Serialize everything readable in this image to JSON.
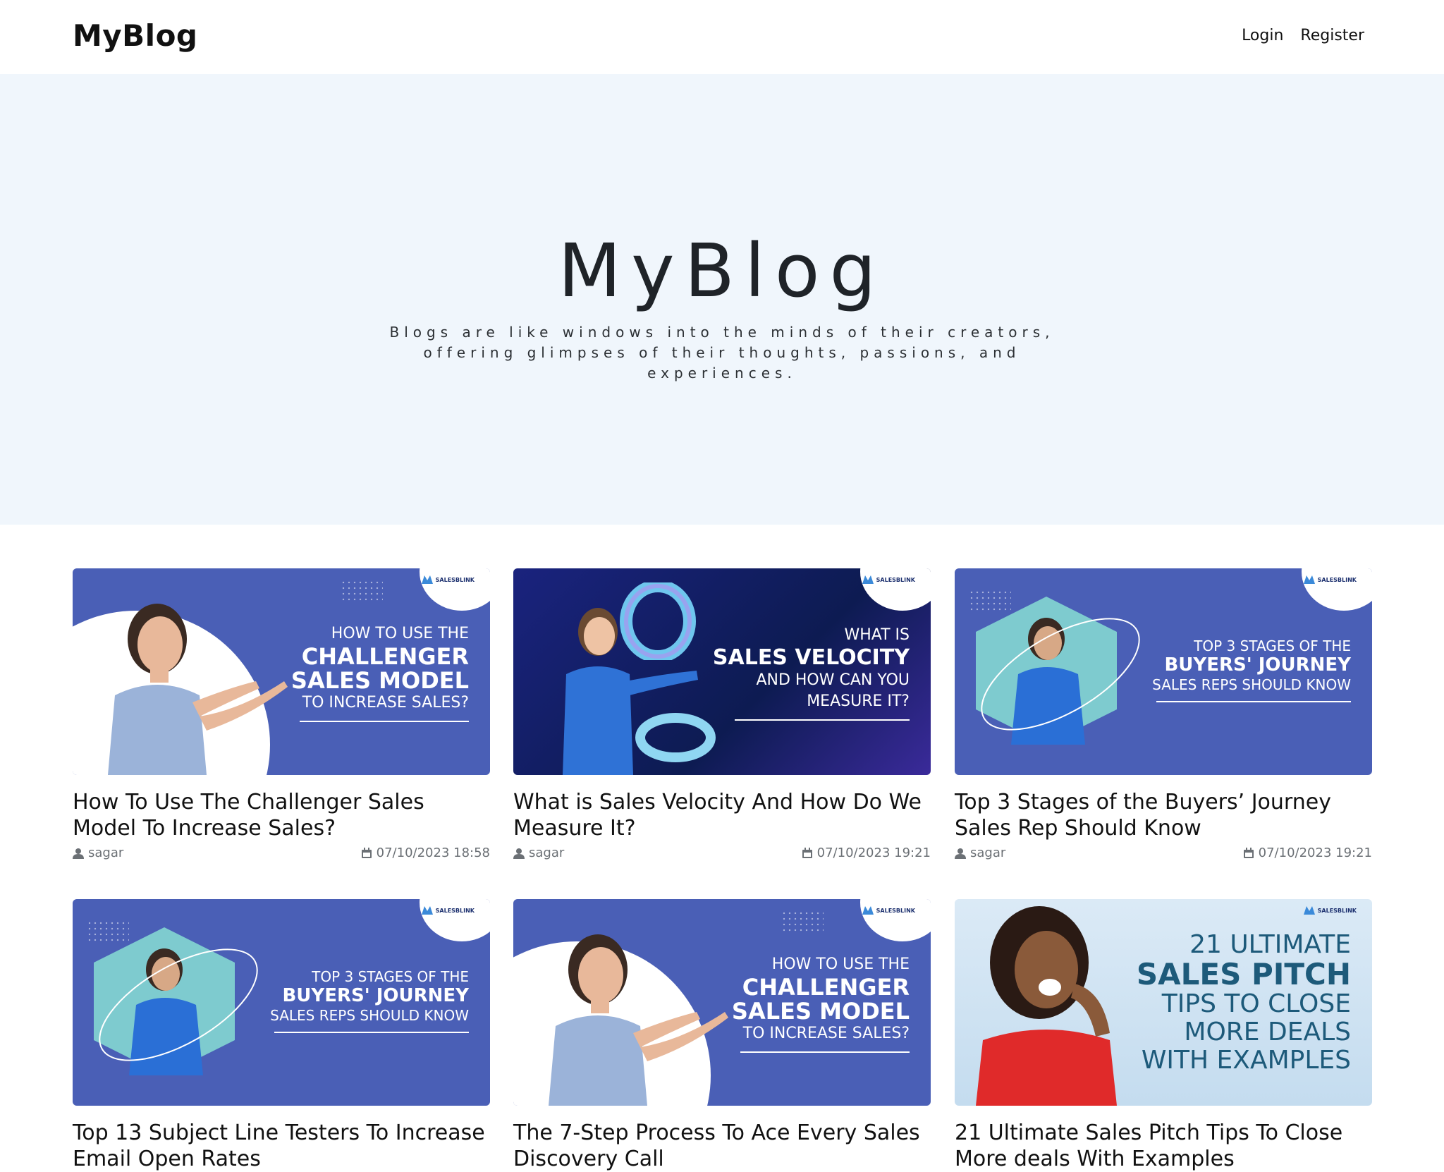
{
  "nav": {
    "brand": "MyBlog",
    "login": "Login",
    "register": "Register"
  },
  "hero": {
    "title": "MyBlog",
    "subtitle": "Blogs are like windows into the minds of their creators, offering glimpses of their thoughts, passions, and experiences."
  },
  "brand_logo": "SALESBLINK",
  "posts": [
    {
      "title": "How To Use The Challenger Sales Model To Increase Sales?",
      "author": "sagar",
      "date": "07/10/2023 18:58",
      "banner": {
        "l1": "HOW TO USE THE",
        "l2": "CHALLENGER",
        "l3": "SALES MODEL",
        "l4": "TO INCREASE SALES?"
      }
    },
    {
      "title": "What is Sales Velocity And How Do We Measure It?",
      "author": "sagar",
      "date": "07/10/2023 19:21",
      "banner": {
        "l1": "WHAT IS",
        "l2": "SALES VELOCITY",
        "l3": "AND HOW CAN YOU",
        "l4": "MEASURE IT?"
      }
    },
    {
      "title": "Top 3 Stages of the Buyers’ Journey Sales Rep Should Know",
      "author": "sagar",
      "date": "07/10/2023 19:21",
      "banner": {
        "l1": "TOP 3 STAGES OF THE",
        "l2": "BUYERS' JOURNEY",
        "l3": "SALES REPS SHOULD KNOW"
      }
    },
    {
      "title": "Top 13 Subject Line Testers To Increase Email Open Rates",
      "banner": {
        "l1": "TOP 3 STAGES OF THE",
        "l2": "BUYERS' JOURNEY",
        "l3": "SALES REPS SHOULD KNOW"
      }
    },
    {
      "title": "The 7-Step Process To Ace Every Sales Discovery Call",
      "banner": {
        "l1": "HOW TO USE THE",
        "l2": "CHALLENGER",
        "l3": "SALES MODEL",
        "l4": "TO INCREASE SALES?"
      }
    },
    {
      "title": "21 Ultimate Sales Pitch Tips To Close More deals With Examples",
      "banner": {
        "l1": "21 ULTIMATE",
        "l2": "SALES PITCH",
        "l3": "TIPS TO CLOSE",
        "l4": "MORE DEALS",
        "l5": "WITH EXAMPLES"
      }
    }
  ],
  "colors": {
    "hero_bg": "#f0f6fc",
    "banner_blue": "#4a5fb6",
    "banner_navy": "#0d1b52",
    "banner_light": "#cfe3f2",
    "banner_teal_text": "#1d5a7a"
  },
  "icons": {
    "author": "user-icon",
    "date": "calendar-icon"
  }
}
